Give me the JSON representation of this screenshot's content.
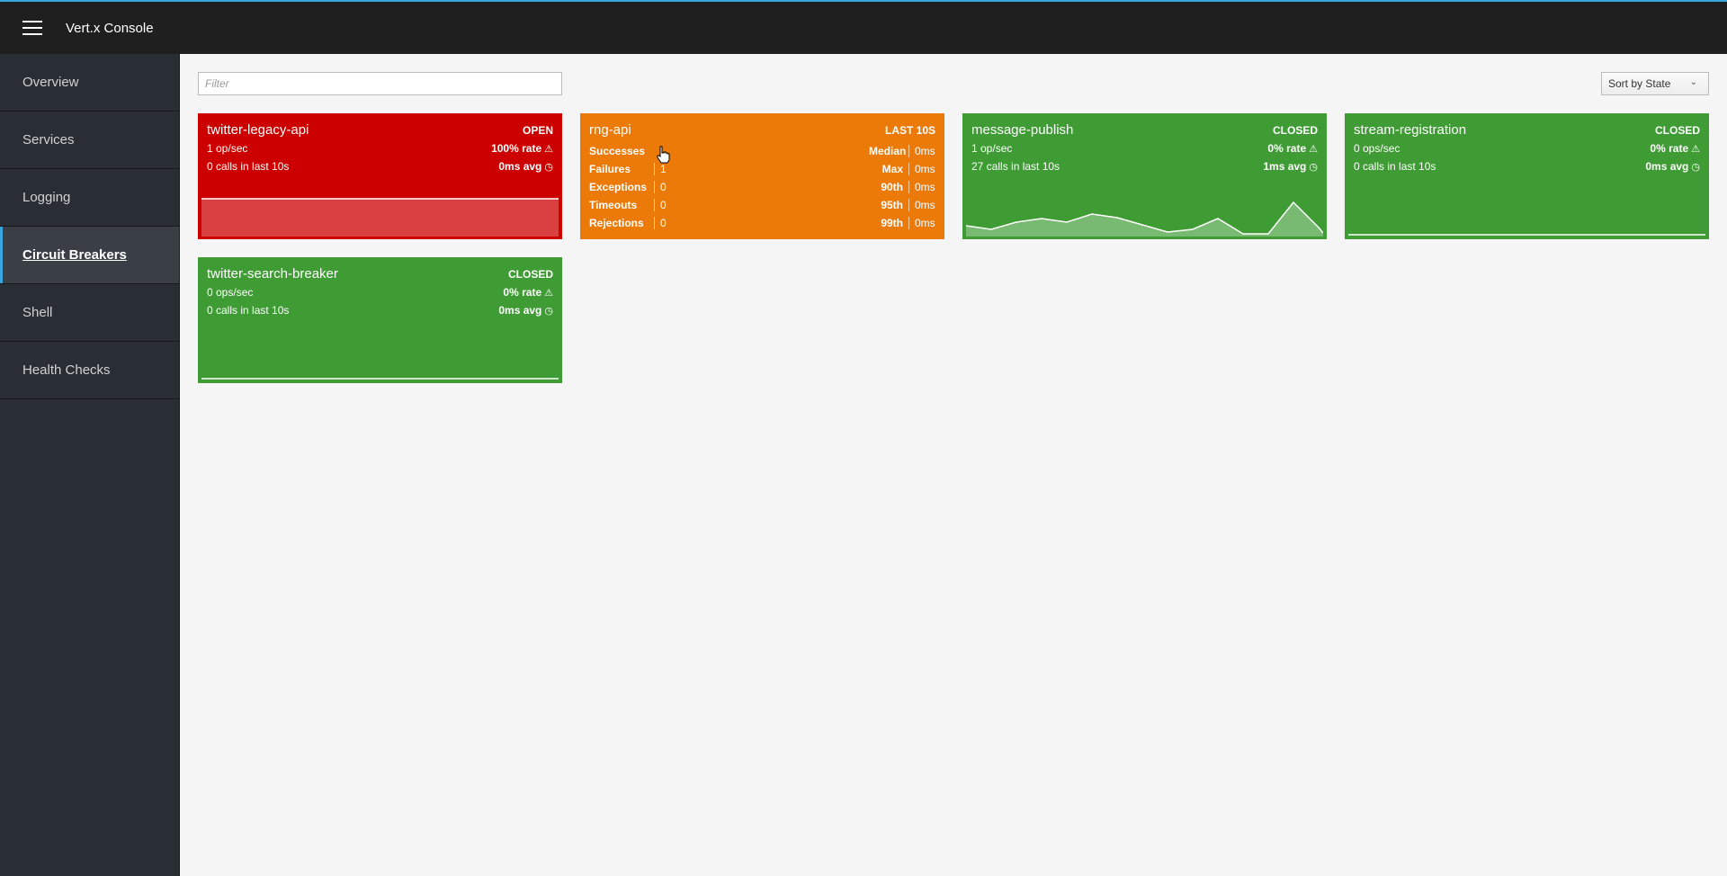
{
  "app": {
    "title": "Vert.x Console"
  },
  "sidebar": {
    "items": [
      {
        "label": "Overview"
      },
      {
        "label": "Services"
      },
      {
        "label": "Logging"
      },
      {
        "label": "Circuit Breakers"
      },
      {
        "label": "Shell"
      },
      {
        "label": "Health Checks"
      }
    ]
  },
  "filter": {
    "placeholder": "Filter"
  },
  "sort": {
    "label": "Sort by State"
  },
  "colors": {
    "open": "#cc0000",
    "half_open": "#ec7a08",
    "closed": "#3f9c35",
    "accent": "#39a5dc"
  },
  "breakers": [
    {
      "name": "twitter-legacy-api",
      "state": "OPEN",
      "ops": "1 op/sec",
      "rate": "100% rate",
      "calls": "0 calls in last 10s",
      "avg": "0ms avg",
      "rate_icon": "warning-icon",
      "avg_icon": "clock-icon"
    },
    {
      "name": "rng-api",
      "state": "LAST 10S",
      "stats": [
        {
          "label": "Successes",
          "value": "",
          "pct_label": "Median",
          "pct_value": "0ms"
        },
        {
          "label": "Failures",
          "value": "1",
          "pct_label": "Max",
          "pct_value": "0ms"
        },
        {
          "label": "Exceptions",
          "value": "0",
          "pct_label": "90th",
          "pct_value": "0ms"
        },
        {
          "label": "Timeouts",
          "value": "0",
          "pct_label": "95th",
          "pct_value": "0ms"
        },
        {
          "label": "Rejections",
          "value": "0",
          "pct_label": "99th",
          "pct_value": "0ms"
        }
      ]
    },
    {
      "name": "message-publish",
      "state": "CLOSED",
      "ops": "1 op/sec",
      "rate": "0% rate",
      "calls": "27 calls in last 10s",
      "avg": "1ms avg",
      "rate_icon": "warning-icon",
      "avg_icon": "clock-icon"
    },
    {
      "name": "stream-registration",
      "state": "CLOSED",
      "ops": "0 ops/sec",
      "rate": "0% rate",
      "calls": "0 calls in last 10s",
      "avg": "0ms avg",
      "rate_icon": "warning-icon",
      "avg_icon": "clock-icon"
    },
    {
      "name": "twitter-search-breaker",
      "state": "CLOSED",
      "ops": "0 ops/sec",
      "rate": "0% rate",
      "calls": "0 calls in last 10s",
      "avg": "0ms avg",
      "rate_icon": "warning-icon",
      "avg_icon": "clock-icon"
    }
  ]
}
